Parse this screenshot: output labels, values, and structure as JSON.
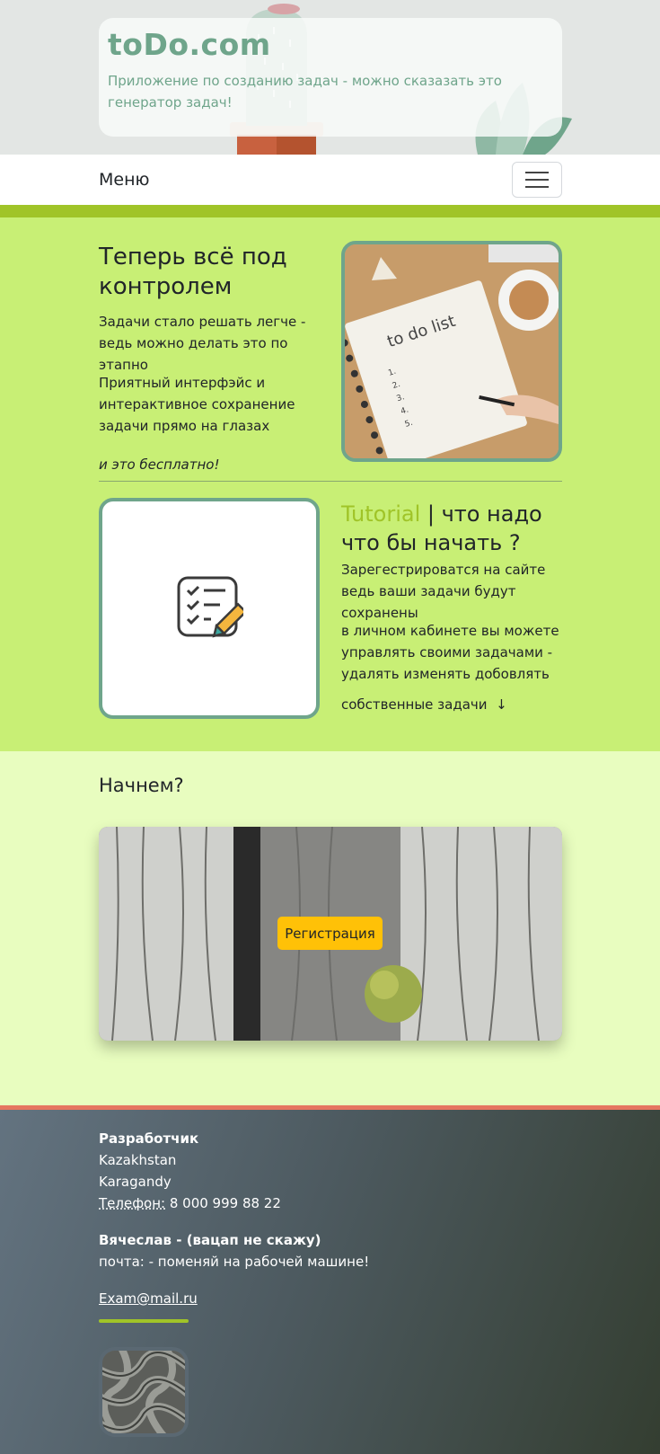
{
  "header": {
    "brand": "toDo.com",
    "tagline": "Приложение по созданию задач - можно сказазать это генератор задач!"
  },
  "navbar": {
    "menu_label": "Меню",
    "toggler_icon": "hamburger-icon"
  },
  "intro": {
    "title": "Теперь всё под контролем",
    "paragraph1": "Задачи стало решать легче - ведь можно делать это по этапно",
    "paragraph2": "Приятный интерфэйс и интерактивное сохранение задачи прямо на глазах",
    "paragraph3": "и это бесплатно!",
    "photo_text": "to do list"
  },
  "tutorial": {
    "title_accent": "Tutorial",
    "title_rest": " | что надо что бы начать ?",
    "paragraph1": "Зарегестрироватся на сайте ведь ваши задачи будут сохранены",
    "paragraph2": "в личном кабинете вы можете управлять своими задачами - удалять изменять добовлять",
    "paragraph3": "собственные задачи",
    "arrow": "↓",
    "icon": "checklist-pencil-icon"
  },
  "start": {
    "title": "Начнем?",
    "register_label": "Регистрация"
  },
  "footer": {
    "heading": "Разработчик",
    "country": "Kazakhstan",
    "city": "Karagandy",
    "phone_label": "Телефон:",
    "phone": " 8 000 999 88 22",
    "developer": "Вячеслав - (вацап не скажу)",
    "mail_note": "почта: - поменяй на рабочей машине!",
    "email": "Exam@mail.ru"
  },
  "colors": {
    "accent_green": "#a0c428",
    "brand_teal": "#6fa58b",
    "section_green": "#c8ef75",
    "section_light": "#e8fdbf",
    "button_yellow": "#ffc107",
    "footer_border": "#e57560"
  }
}
